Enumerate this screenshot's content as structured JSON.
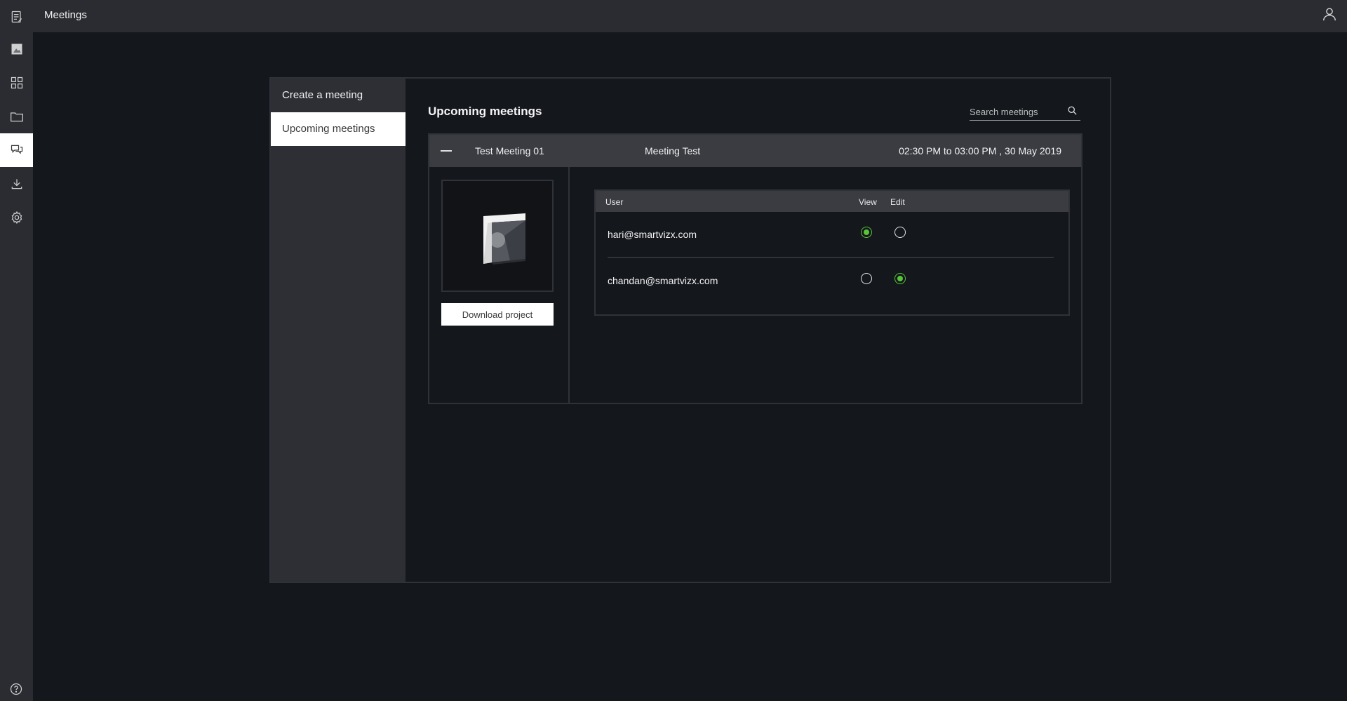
{
  "app": {
    "title": "Meetings"
  },
  "rail": {
    "items": [
      {
        "icon": "notes-icon"
      },
      {
        "icon": "image-icon"
      },
      {
        "icon": "grid-icon"
      },
      {
        "icon": "folder-icon"
      },
      {
        "icon": "chat-icon",
        "active": true
      },
      {
        "icon": "download-icon"
      },
      {
        "icon": "gear-icon"
      }
    ],
    "help_icon": "help-icon"
  },
  "sidebar": {
    "items": [
      {
        "label": "Create a meeting"
      },
      {
        "label": "Upcoming meetings",
        "selected": true
      }
    ]
  },
  "main": {
    "title": "Upcoming meetings",
    "search": {
      "placeholder": "Search meetings",
      "value": ""
    }
  },
  "meeting": {
    "name": "Test Meeting 01",
    "description": "Meeting Test",
    "time": "02:30 PM to 03:00 PM , 30 May 2019",
    "download_label": "Download project",
    "table": {
      "headers": {
        "user": "User",
        "view": "View",
        "edit": "Edit"
      },
      "rows": [
        {
          "email": "hari@smartvizx.com",
          "view": true,
          "edit": false
        },
        {
          "email": "chandan@smartvizx.com",
          "view": false,
          "edit": true
        }
      ]
    }
  },
  "colors": {
    "background": "#14171c",
    "bar": "#2a2c31",
    "accent_green": "#58c437"
  }
}
